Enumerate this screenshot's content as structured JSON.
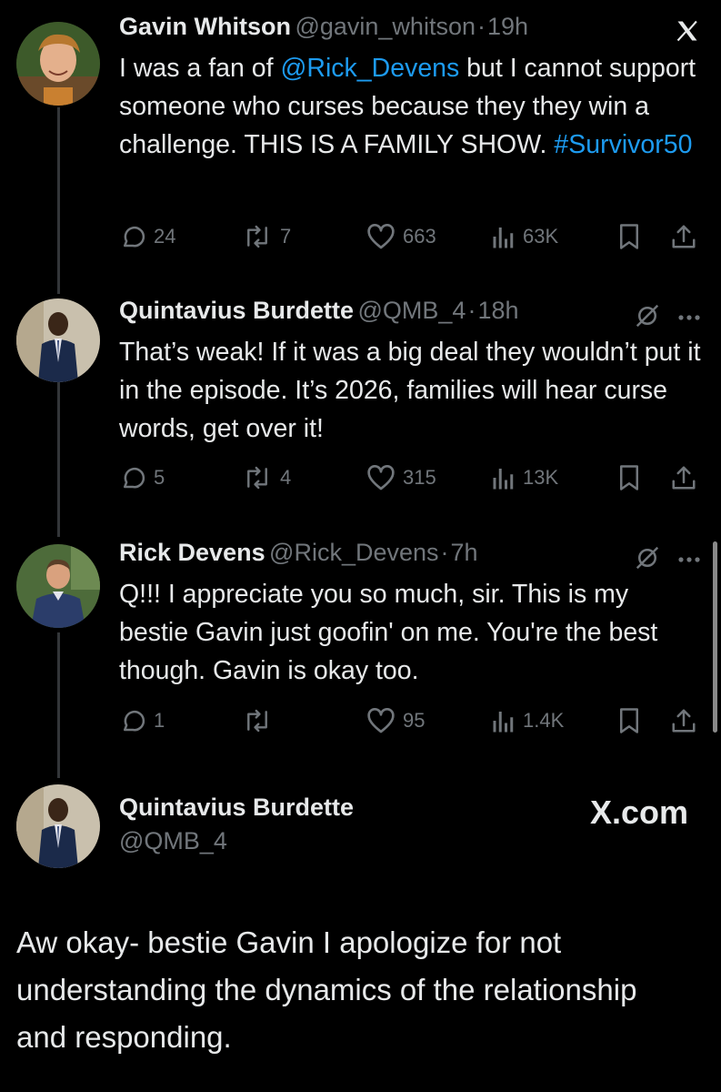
{
  "tweets": [
    {
      "name": "Gavin Whitson",
      "handle": "@gavin_whitson",
      "separator": "·",
      "time": "19h",
      "text_before": "I was a fan of ",
      "mention": "@Rick_Devens",
      "text_middle": " but I cannot support someone who curses because they they win a challenge. THIS IS A FAMILY SHOW. ",
      "hashtag": "#Survivor50",
      "replies": "24",
      "reposts": "7",
      "likes": "663",
      "views": "63K"
    },
    {
      "name": "Quintavius Burdette",
      "handle": "@QMB_4",
      "separator": "·",
      "time": "18h",
      "text": "That’s weak! If it was a big deal they wouldn’t put it in the episode. It’s 2026, families will hear curse words, get over it!",
      "replies": "5",
      "reposts": "4",
      "likes": "315",
      "views": "13K"
    },
    {
      "name": "Rick Devens",
      "handle": "@Rick_Devens",
      "separator": "·",
      "time": "7h",
      "text": "Q!!! I appreciate you so much, sir. This is my bestie Gavin just goofin' on me. You're the best though. Gavin is okay too.",
      "replies": "1",
      "reposts": "",
      "likes": "95",
      "views": "1.4K"
    }
  ],
  "quote": {
    "name": "Quintavius Burdette",
    "handle": "@QMB_4",
    "brand": "X.com",
    "text": "Aw okay- bestie Gavin I apologize for not understanding the dynamics of the relationship and responding."
  },
  "colors": {
    "background": "#000000",
    "text": "#e7e9ea",
    "muted": "#71767b",
    "link": "#1d9bf0",
    "thread_line": "#333639"
  },
  "icons": [
    "x-logo-icon",
    "grok-icon",
    "more-icon",
    "reply-icon",
    "repost-icon",
    "like-icon",
    "views-icon",
    "bookmark-icon",
    "share-icon"
  ]
}
